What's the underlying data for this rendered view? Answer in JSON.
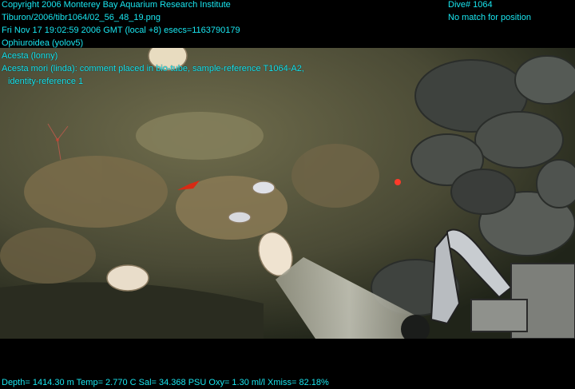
{
  "overlay": {
    "copyright": "Copyright 2006 Monterey Bay Aquarium Research Institute",
    "file_path": "Tiburon/2006/tibr1064/02_56_48_19.png",
    "timestamp": "Fri Nov 17 19:02:59 2006 GMT (local +8)  esecs=1163790179",
    "annotation_1": "Ophiuroidea (yolov5)",
    "annotation_2": "Acesta (lonny)",
    "annotation_3": "Acesta mori (linda): comment placed in bio-tube, sample-reference T1064-A2,",
    "annotation_4": "identity-reference 1",
    "dive": "Dive# 1064",
    "position_status": "No match for position",
    "telemetry": "Depth= 1414.30 m  Temp= 2.770 C  Sal= 34.368 PSU  Oxy= 1.30 ml/l  Xmiss= 82.18%"
  },
  "colors": {
    "overlay_text": "#19e6f0",
    "background": "#000000"
  }
}
